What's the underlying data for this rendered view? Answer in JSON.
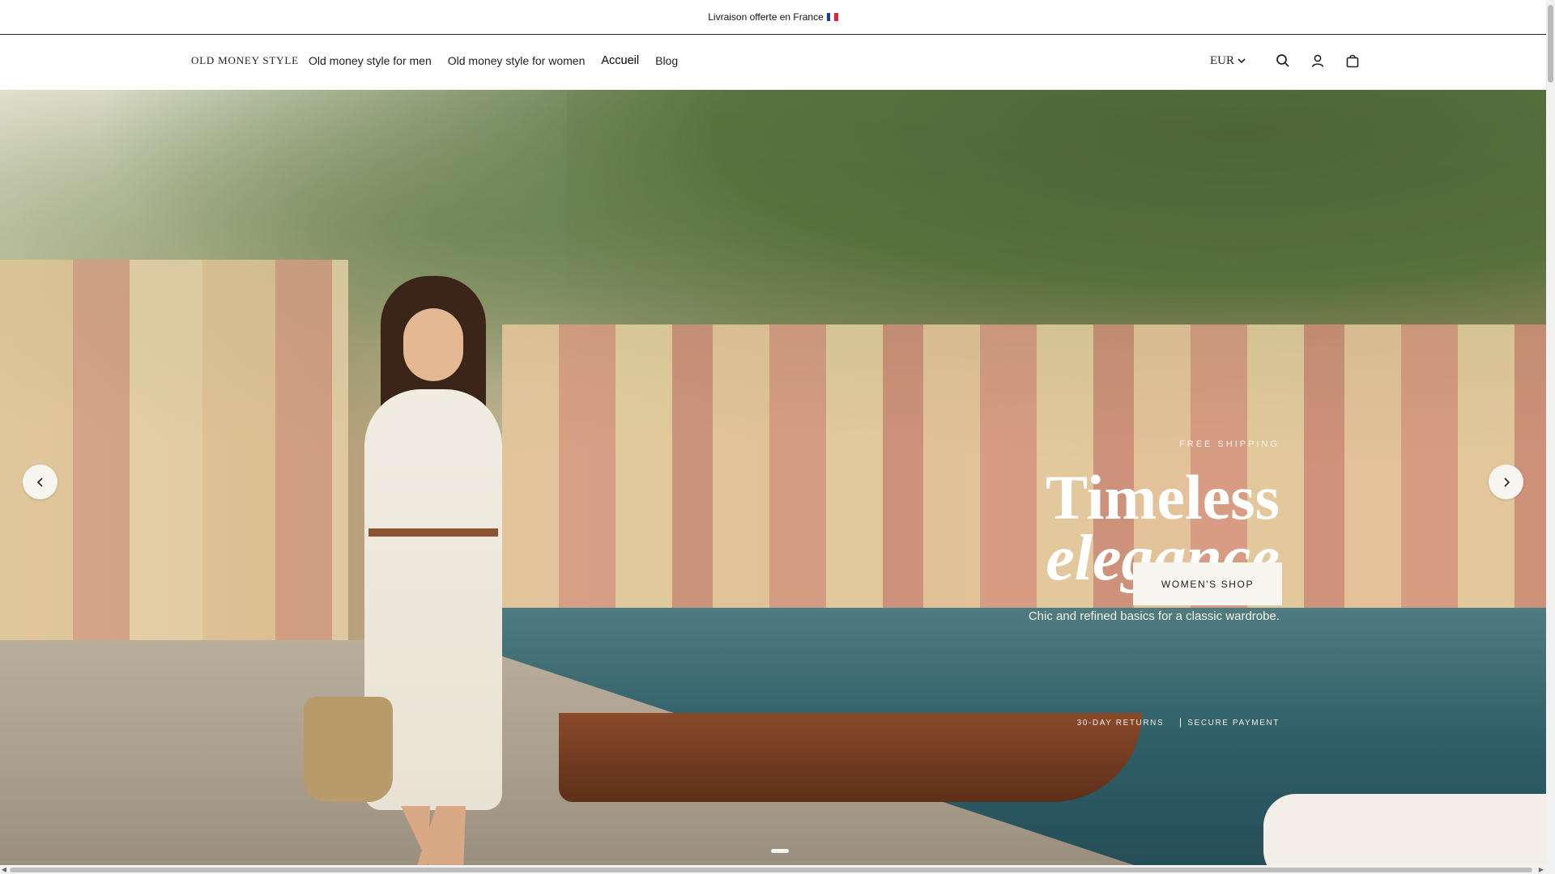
{
  "announcement": {
    "text": "Livraison offerte en France",
    "flag": "french-flag-icon"
  },
  "header": {
    "logo": "OLD MONEY STYLE",
    "nav": [
      {
        "label": "Old money style for men"
      },
      {
        "label": "Old money style for women"
      },
      {
        "label": "Accueil",
        "active": true
      },
      {
        "label": "Blog"
      }
    ],
    "currency": "EUR",
    "icons": [
      "chevron-down-icon",
      "search-icon",
      "account-icon",
      "cart-icon"
    ]
  },
  "hero": {
    "kicker": "FREE SHIPPING",
    "title_line1": "Timeless",
    "title_line2": "elegance",
    "subtitle": "Chic and refined basics for a classic wardrobe.",
    "cta_label": "WOMEN'S SHOP",
    "badge_1": "30-DAY RETURNS",
    "badge_2": "SECURE PAYMENT",
    "prev_icon": "chevron-left-icon",
    "next_icon": "chevron-right-icon"
  },
  "colors": {
    "accent": "#f7f5f0",
    "text": "#111111"
  }
}
